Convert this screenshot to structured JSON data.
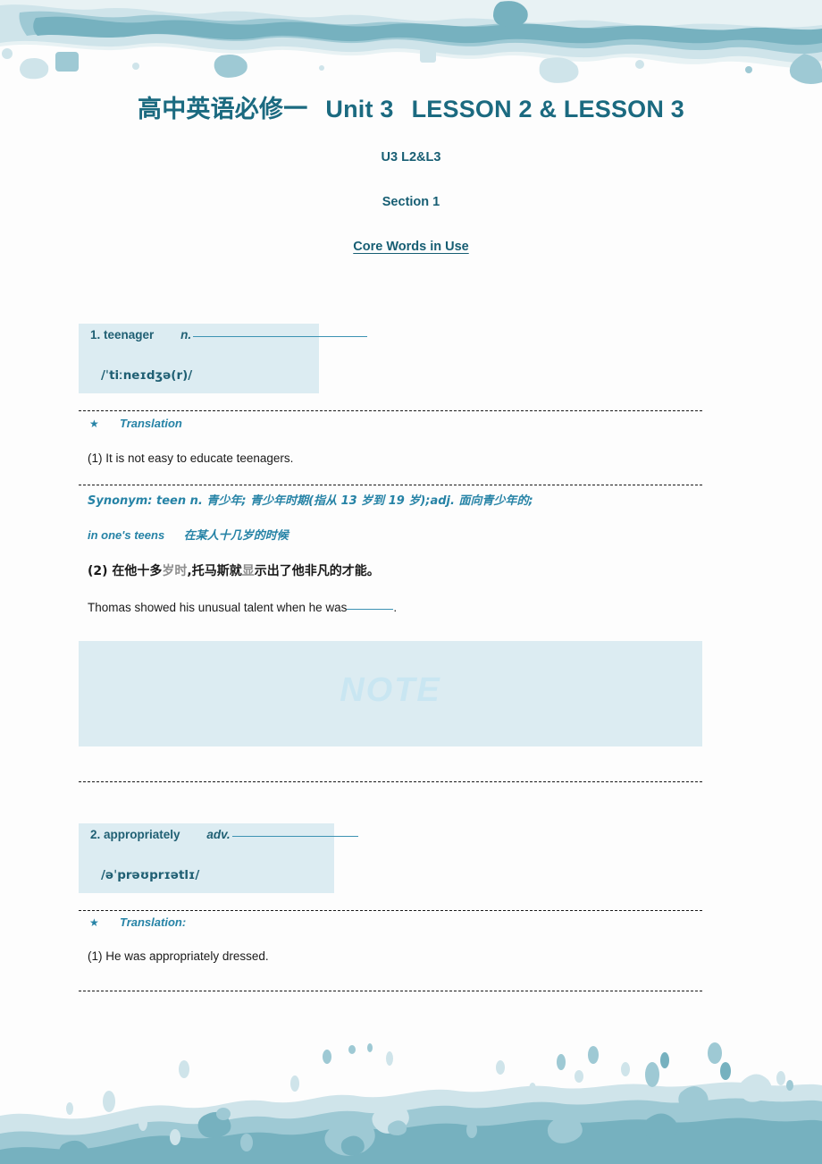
{
  "document": {
    "title_main_cn": "高中英语必修一",
    "title_main_unit": "Unit 3",
    "title_main_lessons": "LESSON 2 & LESSON 3",
    "subtitle_1": "U3 L2&L3",
    "subtitle_2": "Section 1",
    "subtitle_3": "Core Words in Use"
  },
  "colors": {
    "heading_teal": "#1b6a80",
    "entry_text": "#1f5f73",
    "entry_box_bg": "#dcecf2",
    "accent_blue": "#2683a6",
    "rule_blue": "#3d93b3",
    "note_watermark": "#c9e6f2",
    "dash_line": "#1a1a1a",
    "deco_teal_dark": "#76b1bf",
    "deco_teal_mid": "#9ec9d4",
    "deco_teal_light": "#cfe4ea",
    "deco_teal_pale": "#e8f2f4"
  },
  "entries": [
    {
      "number": "1.",
      "word": "teenager",
      "pos": "n.",
      "phonetic": "/ˈtiːneɪdʒə(r)/",
      "translation_label": "Translation",
      "star_glyph": "★",
      "examples": [
        "(1) It is not easy to educate teenagers."
      ],
      "synonym_line_1": "Synonym: teen n.  青少年;  青少年时期(指从 13  岁到 19  岁);adj.   面向青少年的;",
      "synonym_line_2_en": "in one's teens",
      "synonym_line_2_cn": "在某人十几岁的时候",
      "example_2_cn_prefix": "(2)  在他十多",
      "example_2_cn_faded_a": "岁时",
      "example_2_cn_mid": ",托马斯就",
      "example_2_cn_faded_b": "显",
      "example_2_cn_suffix": "示出了他非凡的才能。",
      "example_2_en_before": "Thomas showed his unusual talent when he was",
      "example_2_en_after": "."
    },
    {
      "number": "2.",
      "word": "appropriately",
      "pos": "adv.",
      "phonetic": "/əˈprəʊprɪətlɪ/",
      "translation_label": "Translation:",
      "star_glyph": "★",
      "examples": [
        "(1) He was appropriately dressed."
      ]
    }
  ],
  "note_box": {
    "watermark": "NOTE"
  }
}
